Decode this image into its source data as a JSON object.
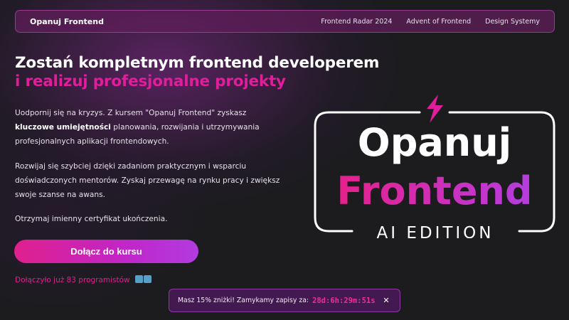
{
  "nav": {
    "brand": "Opanuj Frontend",
    "links": [
      "Frontend Radar 2024",
      "Advent of Frontend",
      "Design Systemy"
    ]
  },
  "hero": {
    "headline_line1": "Zostań kompletnym frontend developerem",
    "headline_line2": "i realizuj profesjonalne projekty",
    "p1_part1": "Uodpornij się na kryzys. Z kursem \"Opanuj Frontend\" zyskasz",
    "p1_strong": "kluczowe umiejętności",
    "p1_part2": "planowania, rozwijania i utrzymywania profesjonalnych aplikacji frontendowych.",
    "p2": "Rozwijaj się szybciej dzięki zadaniom praktycznym i wsparciu doświadczonych mentorów. Zyskaj przewagę na rynku pracy i zwiększ swoje szanse na awans.",
    "p3": "Otrzymaj imienny certyfikat ukończenia.",
    "cta_label": "Dołącz do kursu",
    "joined_text": "Dołączyło już 83 programistów"
  },
  "logo": {
    "line1": "Opanuj",
    "line2": "Frontend",
    "edition": "AI EDITION",
    "icon": "lightning-bolt-icon"
  },
  "banner": {
    "text": "Masz 15% zniżki! Zamykamy zapisy za:",
    "timer": "28d:6h:29m:51s",
    "close_icon": "close-icon"
  },
  "colors": {
    "accent_pink": "#e11d9c",
    "accent_purple": "#b23be0",
    "background": "#1c1c1f"
  }
}
